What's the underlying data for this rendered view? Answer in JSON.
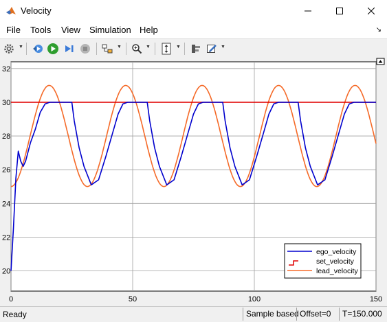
{
  "window": {
    "title": "Velocity"
  },
  "menu": [
    "File",
    "Tools",
    "View",
    "Simulation",
    "Help"
  ],
  "toolbar": {
    "icons": [
      "settings-icon",
      "step-back-icon",
      "run-icon",
      "step-forward-icon",
      "stop-icon",
      "highlight-block-icon",
      "zoom-icon",
      "autoscale-icon",
      "cursor-measure-icon",
      "style-icon"
    ]
  },
  "status": {
    "ready": "Ready",
    "sample": "Sample based",
    "offset": "Offset=0",
    "time": "T=150.000"
  },
  "colors": {
    "ego": "#0000cd",
    "set": "#e00000",
    "lead": "#f56a28",
    "grid": "#a0a0a0"
  },
  "chart_data": {
    "type": "line",
    "title": "",
    "xlabel": "",
    "ylabel": "",
    "xlim": [
      0,
      150
    ],
    "ylim": [
      18.8,
      32.4
    ],
    "xticks": [
      0,
      50,
      100,
      150
    ],
    "yticks": [
      20,
      22,
      24,
      26,
      28,
      30,
      32
    ],
    "grid": true,
    "legend_position": "bottom-right",
    "series": [
      {
        "name": "ego_velocity",
        "x": [
          0,
          1,
          2,
          3,
          4,
          5,
          6,
          8,
          10,
          12,
          14,
          16,
          20,
          25,
          26,
          28,
          30,
          33,
          36,
          39,
          42,
          44,
          46,
          48,
          52,
          56,
          57,
          59,
          61,
          64,
          67,
          70,
          73,
          75,
          77,
          79,
          83,
          87,
          88,
          90,
          92,
          95,
          98,
          101,
          104,
          106,
          108,
          110,
          114,
          118,
          119,
          121,
          123,
          126,
          129,
          132,
          135,
          137,
          139,
          141,
          145,
          150
        ],
        "y": [
          20,
          22.5,
          25.5,
          27.1,
          26.5,
          26.2,
          26.5,
          27.6,
          28.4,
          29.4,
          29.9,
          30,
          30,
          30,
          28.9,
          27.3,
          26.2,
          25.1,
          25.4,
          26.8,
          28.3,
          29.3,
          29.9,
          30,
          30,
          30,
          28.9,
          27.3,
          26.2,
          25.1,
          25.4,
          26.8,
          28.3,
          29.3,
          29.9,
          30,
          30,
          30,
          28.9,
          27.3,
          26.2,
          25.1,
          25.4,
          26.8,
          28.3,
          29.3,
          29.9,
          30,
          30,
          30,
          28.9,
          27.3,
          26.2,
          25.1,
          25.4,
          26.8,
          28.3,
          29.3,
          29.9,
          30,
          30,
          30
        ]
      },
      {
        "name": "set_velocity",
        "x": [
          0,
          150
        ],
        "y": [
          30,
          30
        ]
      },
      {
        "name": "lead_velocity",
        "wave": {
          "offset": 28,
          "amplitude": 3,
          "period": 31.42
        },
        "y0": 25
      }
    ]
  }
}
